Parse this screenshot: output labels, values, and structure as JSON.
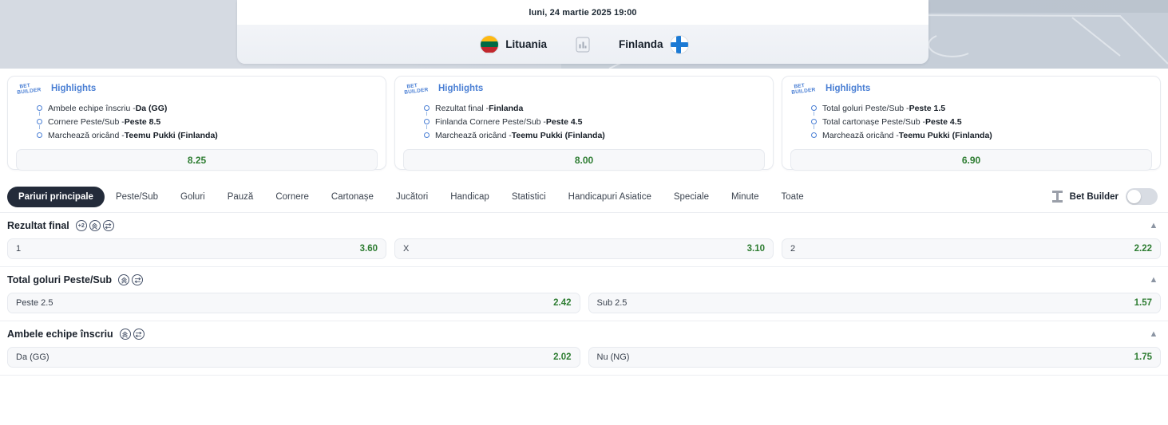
{
  "hero": {
    "datetime": "luni, 24 martie 2025 19:00",
    "home_team": "Lituania",
    "away_team": "Finlanda",
    "stats_icon": "stats-bars-icon",
    "home_flag": "lithuania-flag-icon",
    "away_flag": "finland-flag-icon"
  },
  "bet_builder_cards": [
    {
      "logo_line1": "BET",
      "logo_line2": "BUILDER",
      "title": "Highlights",
      "legs": [
        {
          "market": "Ambele echipe înscriu - ",
          "selection": "Da (GG)"
        },
        {
          "market": "Cornere Peste/Sub - ",
          "selection": "Peste 8.5"
        },
        {
          "market": "Marchează oricând - ",
          "selection": "Teemu Pukki (Finlanda)"
        }
      ],
      "odds": "8.25"
    },
    {
      "logo_line1": "BET",
      "logo_line2": "BUILDER",
      "title": "Highlights",
      "legs": [
        {
          "market": "Rezultat final - ",
          "selection": "Finlanda"
        },
        {
          "market": "Finlanda Cornere Peste/Sub - ",
          "selection": "Peste 4.5"
        },
        {
          "market": "Marchează oricând - ",
          "selection": "Teemu Pukki (Finlanda)"
        }
      ],
      "odds": "8.00"
    },
    {
      "logo_line1": "BET",
      "logo_line2": "BUILDER",
      "title": "Highlights",
      "legs": [
        {
          "market": "Total goluri Peste/Sub - ",
          "selection": "Peste 1.5"
        },
        {
          "market": "Total cartonașe Peste/Sub - ",
          "selection": "Peste 4.5"
        },
        {
          "market": "Marchează oricând - ",
          "selection": "Teemu Pukki (Finlanda)"
        }
      ],
      "odds": "6.90"
    }
  ],
  "tabs": [
    {
      "label": "Pariuri principale",
      "active": true
    },
    {
      "label": "Peste/Sub",
      "active": false
    },
    {
      "label": "Goluri",
      "active": false
    },
    {
      "label": "Pauză",
      "active": false
    },
    {
      "label": "Cornere",
      "active": false
    },
    {
      "label": "Cartonașe",
      "active": false
    },
    {
      "label": "Jucători",
      "active": false
    },
    {
      "label": "Handicap",
      "active": false
    },
    {
      "label": "Statistici",
      "active": false
    },
    {
      "label": "Handicapuri Asiatice",
      "active": false
    },
    {
      "label": "Speciale",
      "active": false
    },
    {
      "label": "Minute",
      "active": false
    },
    {
      "label": "Toate",
      "active": false
    }
  ],
  "bet_builder_toggle": {
    "icon": "bet-builder-icon",
    "label": "Bet Builder",
    "state": "off"
  },
  "markets": [
    {
      "title": "Rezultat final",
      "badges": [
        "plus-two-badge",
        "boost-badge",
        "cashout-badge"
      ],
      "collapse_icon": "chevron-up-icon",
      "selections": [
        {
          "label": "1",
          "odds": "3.60"
        },
        {
          "label": "X",
          "odds": "3.10"
        },
        {
          "label": "2",
          "odds": "2.22"
        }
      ]
    },
    {
      "title": "Total goluri Peste/Sub",
      "badges": [
        "boost-badge",
        "cashout-badge"
      ],
      "collapse_icon": "chevron-up-icon",
      "selections": [
        {
          "label": "Peste 2.5",
          "odds": "2.42"
        },
        {
          "label": "Sub 2.5",
          "odds": "1.57"
        }
      ]
    },
    {
      "title": "Ambele echipe înscriu",
      "badges": [
        "boost-badge",
        "cashout-badge"
      ],
      "collapse_icon": "chevron-up-icon",
      "selections": [
        {
          "label": "Da (GG)",
          "odds": "2.02"
        },
        {
          "label": "Nu (NG)",
          "odds": "1.75"
        }
      ]
    }
  ],
  "colors": {
    "odds_green": "#2e7d32",
    "brand_blue": "#4a7fd4",
    "active_tab_bg": "#232b3a"
  }
}
